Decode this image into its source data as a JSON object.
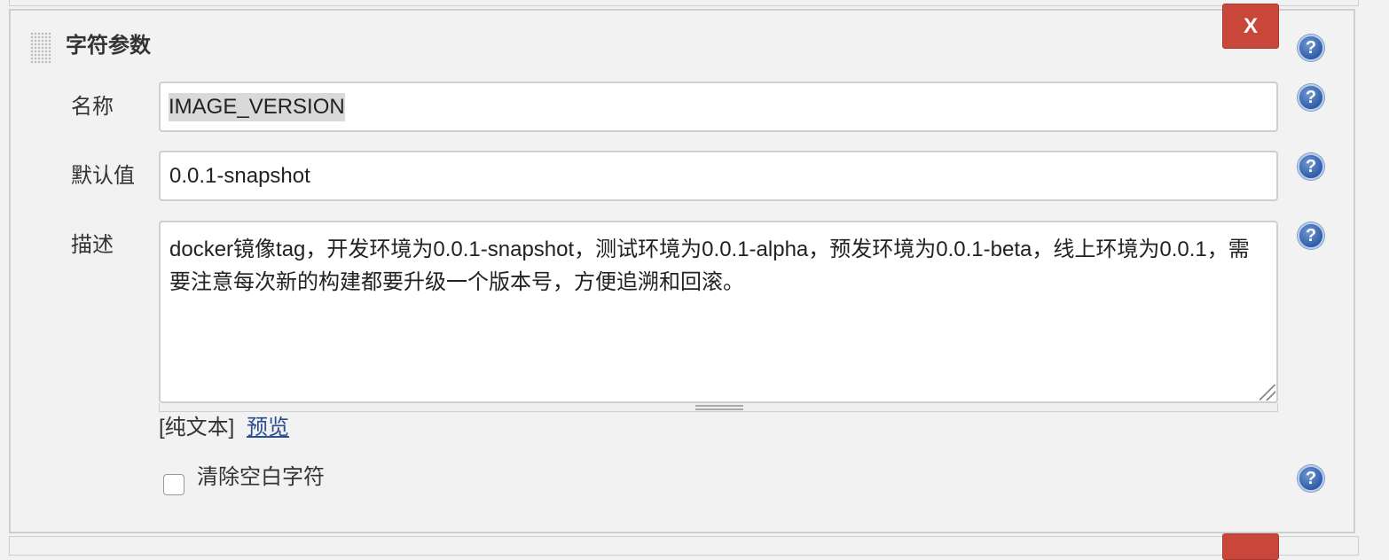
{
  "section": {
    "title": "字符参数",
    "delete_label": "X"
  },
  "help_label": "?",
  "fields": {
    "name": {
      "label": "名称",
      "value": "IMAGE_VERSION"
    },
    "default": {
      "label": "默认值",
      "value": "0.0.1-snapshot"
    },
    "description": {
      "label": "描述",
      "value": "docker镜像tag，开发环境为0.0.1-snapshot，测试环境为0.0.1-alpha，预发环境为0.0.1-beta，线上环境为0.0.1，需要注意每次新的构建都要升级一个版本号，方便追溯和回滚。",
      "format_plain": "[纯文本]",
      "preview_link": "预览"
    }
  },
  "trim_option": {
    "label": "清除空白字符",
    "checked": false
  },
  "colors": {
    "delete_button": "#c9473a",
    "help_icon": "#2f5ea9",
    "link": "#2a4f8f",
    "panel_background": "#f2f2f2"
  },
  "icons": {
    "help": "help-icon",
    "drag": "drag-handle-icon"
  }
}
